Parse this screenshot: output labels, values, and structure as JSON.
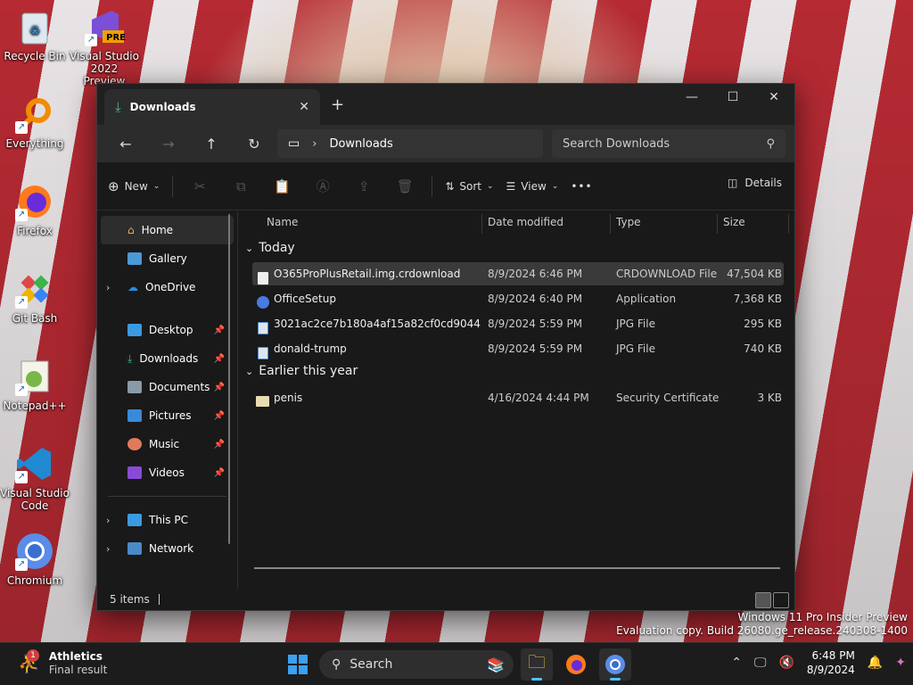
{
  "desktop": {
    "icons": [
      {
        "label": "Recycle Bin"
      },
      {
        "label": "Visual Studio 2022 Preview",
        "badge": "PRE"
      },
      {
        "label": "Everything"
      },
      {
        "label": "Firefox"
      },
      {
        "label": "Git Bash"
      },
      {
        "label": "Notepad++"
      },
      {
        "label": "Visual Studio Code"
      },
      {
        "label": "Chromium"
      }
    ]
  },
  "window": {
    "tab_title": "Downloads",
    "controls": {
      "minimize": "—",
      "maximize": "☐",
      "close": "✕"
    },
    "address": {
      "segment": "Downloads"
    },
    "search_placeholder": "Search Downloads",
    "toolbar": {
      "new_label": "New",
      "sort_label": "Sort",
      "view_label": "View",
      "more_label": "•••",
      "details_label": "Details"
    },
    "sidebar": {
      "home": "Home",
      "gallery": "Gallery",
      "onedrive": "OneDrive",
      "desktop": "Desktop",
      "downloads": "Downloads",
      "documents": "Documents",
      "pictures": "Pictures",
      "music": "Music",
      "videos": "Videos",
      "thispc": "This PC",
      "network": "Network"
    },
    "columns": {
      "name": "Name",
      "date": "Date modified",
      "type": "Type",
      "size": "Size"
    },
    "groups": {
      "today": "Today",
      "earlier": "Earlier this year"
    },
    "files": [
      {
        "name": "O365ProPlusRetail.img.crdownload",
        "date": "8/9/2024 6:46 PM",
        "type": "CRDOWNLOAD File",
        "size": "47,504 KB"
      },
      {
        "name": "OfficeSetup",
        "date": "8/9/2024 6:40 PM",
        "type": "Application",
        "size": "7,368 KB"
      },
      {
        "name": "3021ac2ce7b180a4af15a82cf0cd9044",
        "date": "8/9/2024 5:59 PM",
        "type": "JPG File",
        "size": "295 KB"
      },
      {
        "name": "donald-trump",
        "date": "8/9/2024 5:59 PM",
        "type": "JPG File",
        "size": "740 KB"
      },
      {
        "name": "penis",
        "date": "4/16/2024 4:44 PM",
        "type": "Security Certificate",
        "size": "3 KB"
      }
    ],
    "status": "5 items"
  },
  "watermark": {
    "line1": "Windows 11 Pro Insider Preview",
    "line2": "Evaluation copy. Build 26080.ge_release.240308-1400"
  },
  "taskbar": {
    "widget_badge": "1",
    "widget_title": "Athletics",
    "widget_sub": "Final result",
    "search_label": "Search",
    "time": "6:48 PM",
    "date": "8/9/2024"
  }
}
